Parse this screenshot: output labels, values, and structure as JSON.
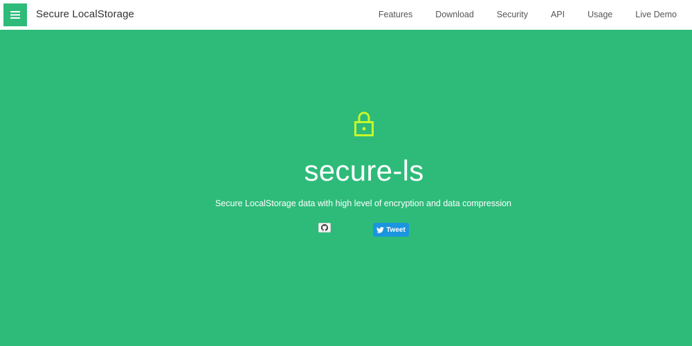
{
  "navbar": {
    "brand": "Secure LocalStorage",
    "menu_icon": "hamburger-icon",
    "links": [
      {
        "label": "Features"
      },
      {
        "label": "Download"
      },
      {
        "label": "Security"
      },
      {
        "label": "API"
      },
      {
        "label": "Usage"
      },
      {
        "label": "Live Demo"
      }
    ]
  },
  "hero": {
    "icon": "lock-icon",
    "title": "secure-ls",
    "subtitle": "Secure LocalStorage data with high level of encryption and data compression",
    "github_icon": "github-icon",
    "tweet_label": "Tweet"
  },
  "colors": {
    "accent": "#2ebb7a",
    "lock": "#c6f82a",
    "tweet": "#1b95e0"
  }
}
